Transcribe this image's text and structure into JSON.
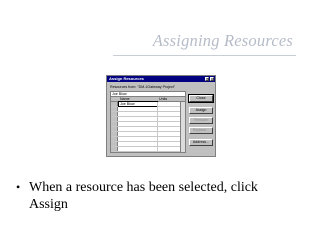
{
  "slide": {
    "title": "Assigning Resources",
    "bullet": "When a resource has been selected, click Assign"
  },
  "dialog": {
    "title": "Assign Resources",
    "resources_from_label": "Resources from: \"DM-1Gateway Project\"",
    "name_input_value": "Joe Blow",
    "columns": [
      "Name",
      "Units"
    ],
    "rows": [
      {
        "name": "Joe Blow",
        "selected": true
      },
      {
        "name": "",
        "selected": false
      },
      {
        "name": "",
        "selected": false
      },
      {
        "name": "",
        "selected": false
      },
      {
        "name": "",
        "selected": false
      },
      {
        "name": "",
        "selected": false
      },
      {
        "name": "",
        "selected": false
      },
      {
        "name": "",
        "selected": false
      },
      {
        "name": "",
        "selected": false
      },
      {
        "name": "",
        "selected": false
      }
    ],
    "buttons": {
      "close": "Close",
      "assign": "Assign",
      "remove": "Remove",
      "replace": "Replace...",
      "address": "Address..."
    },
    "titlebar_buttons": {
      "help": "?",
      "close": "×"
    }
  },
  "colors": {
    "title": "#b5bcc7",
    "dialog_face": "#c0c0c0",
    "titlebar": "#000080"
  }
}
